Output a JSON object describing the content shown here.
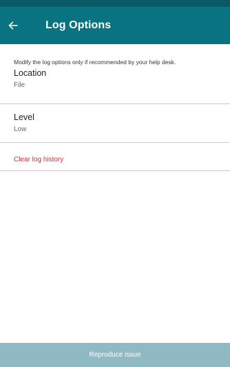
{
  "header": {
    "title": "Log Options",
    "back_icon": "arrow-left-icon"
  },
  "intro_text": "Modify the log options only if recommended by your help desk.",
  "settings": [
    {
      "label": "Location",
      "value": "File"
    },
    {
      "label": "Level",
      "value": "Low"
    }
  ],
  "clear_log_label": "Clear log history",
  "reproduce_button_label": "Reproduce issue",
  "colors": {
    "app_bar": "#0a7382",
    "status_bar": "#0b5866",
    "danger_text": "#e3262b",
    "bottom_button": "#8fbac4"
  }
}
